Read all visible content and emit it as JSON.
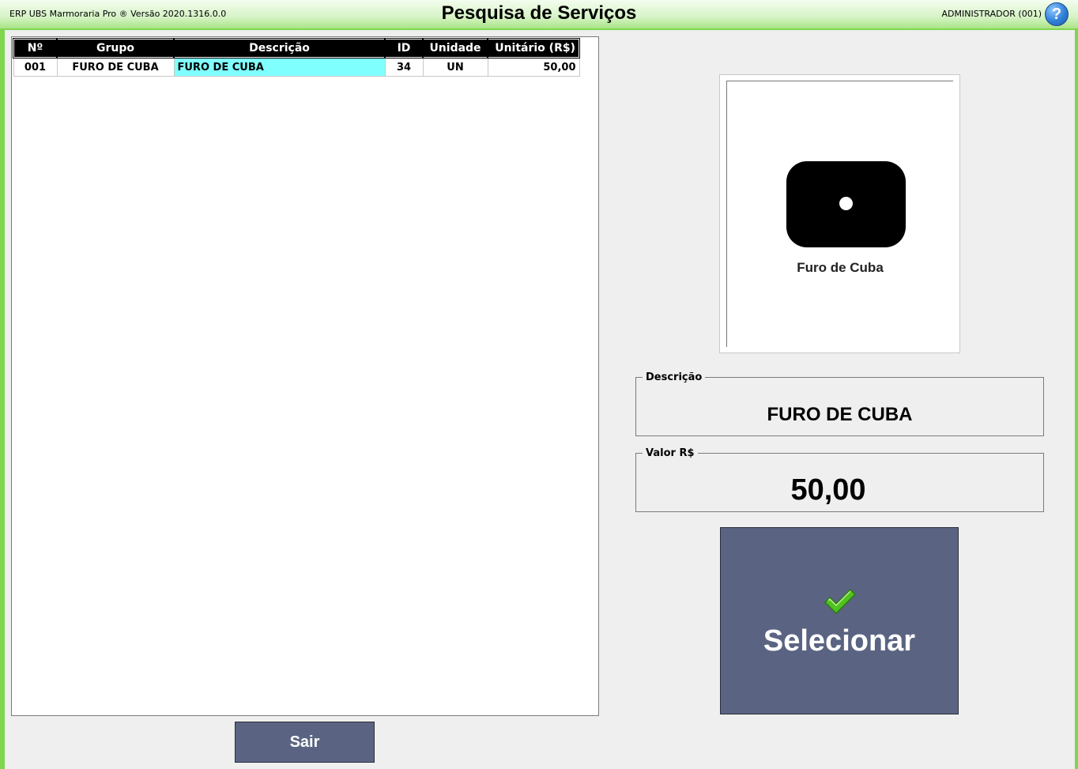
{
  "titlebar": {
    "app_version": "ERP UBS Marmoraria Pro ® Versão 2020.1316.0.0",
    "title": "Pesquisa de Serviços",
    "user": "ADMINISTRADOR (001)",
    "help_icon": "help-icon",
    "help_glyph": "?"
  },
  "grid": {
    "columns": [
      "Nº",
      "Grupo",
      "Descrição",
      "ID",
      "Unidade",
      "Unitário (R$)"
    ],
    "rows": [
      {
        "num": "001",
        "grupo": "FURO DE CUBA",
        "descricao": "FURO DE CUBA",
        "id": "34",
        "unidade": "UN",
        "unitario": "50,00"
      }
    ],
    "selected_row": 0,
    "selected_color": "#80ffff"
  },
  "preview": {
    "icon": "sink-hole-icon",
    "caption": "Furo de Cuba"
  },
  "details": {
    "descricao_label": "Descrição",
    "descricao_value": "FURO DE CUBA",
    "valor_label": "Valor R$",
    "valor_value": "50,00"
  },
  "buttons": {
    "exit_label": "Sair",
    "select_label": "Selecionar",
    "select_icon": "check-icon",
    "button_color": "#5a6482"
  },
  "colors": {
    "frame_accent": "#7fd650",
    "background": "#efefef"
  }
}
